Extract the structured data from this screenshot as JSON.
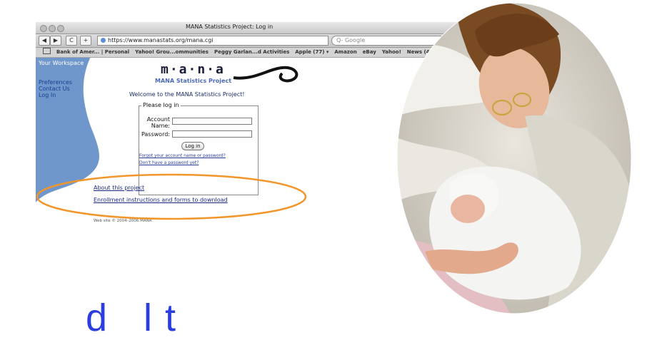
{
  "browser": {
    "window_title": "MANA Statistics Project: Log in",
    "url": "https://www.manastats.org/mana.cgi",
    "search_placeholder": "Q- Google",
    "nav_back": "◀",
    "nav_forward": "▶",
    "reload": "C",
    "add": "+",
    "bookmarks": [
      "Bank of Amer... | Personal",
      "Yahoo! Grou...ommunities",
      "Peggy Garlan...d Activities",
      "Apple (77) ▾",
      "Amazon",
      "eBay",
      "Yahoo!",
      "News (41) ▾"
    ]
  },
  "sidebar": {
    "workspace": "Your Workspace",
    "items": [
      "Preferences",
      "Contact Us",
      "Log In"
    ]
  },
  "header": {
    "logo": "m·a·n·a",
    "subtitle": "MANA Statistics Project"
  },
  "main": {
    "welcome": "Welcome to the MANA Statistics Project!",
    "login": {
      "legend": "Please log in",
      "account_label_1": "Account",
      "account_label_2": "Name:",
      "password_label": "Password:",
      "button": "Log in",
      "forgot_link": "Forgot your account name or password?",
      "no_password_link": "Don't have a password yet?"
    },
    "links": [
      "About this project",
      "Enrollment instructions and forms to download"
    ],
    "footer": "Web site © 2004–2006 MANA"
  },
  "colors": {
    "sidebar_blue": "#6f97cc",
    "highlight_orange": "#f2952a",
    "bottom_text_blue": "#2a3ee0"
  },
  "bottom_text": "d  lt"
}
